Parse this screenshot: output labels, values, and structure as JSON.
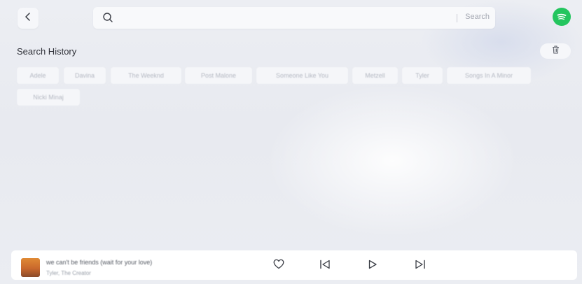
{
  "header": {
    "back_icon": "chevron-left-icon",
    "search": {
      "placeholder": "",
      "button_label": "Search",
      "icon": "search-icon"
    },
    "brand_icon": "spotify-icon",
    "brand_color": "#23c55e"
  },
  "history": {
    "title": "Search History",
    "clear_icon": "trash-icon",
    "items": [
      "Adele",
      "Davina",
      "The Weeknd",
      "Post Malone",
      "Someone Like You",
      "Metzell",
      "Tyler",
      "Songs In A Minor",
      "Nicki Minaj"
    ]
  },
  "player": {
    "title": "we can't be friends (wait for your love)",
    "artist": "Tyler, The Creator",
    "icons": [
      "heart-icon",
      "skip-previous-icon",
      "play-icon",
      "skip-next-icon"
    ]
  }
}
